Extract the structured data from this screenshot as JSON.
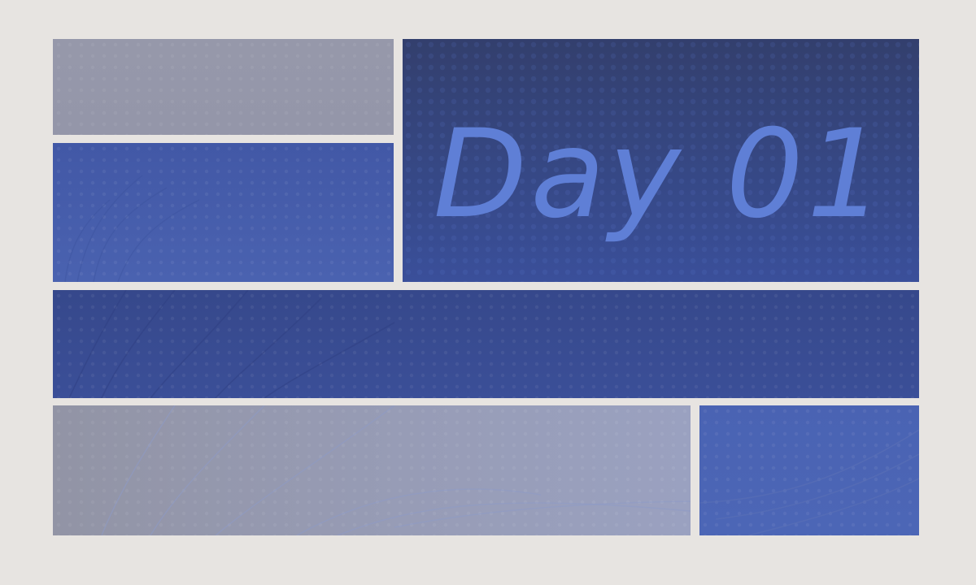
{
  "title": {
    "text": "Day 01"
  },
  "colors": {
    "page_background": "#e7e4e1",
    "title_ink": "#5f7fd6",
    "panel_gray": "#9698aa",
    "panel_blue": "#4a62b0",
    "panel_navy": "#333f6d"
  }
}
